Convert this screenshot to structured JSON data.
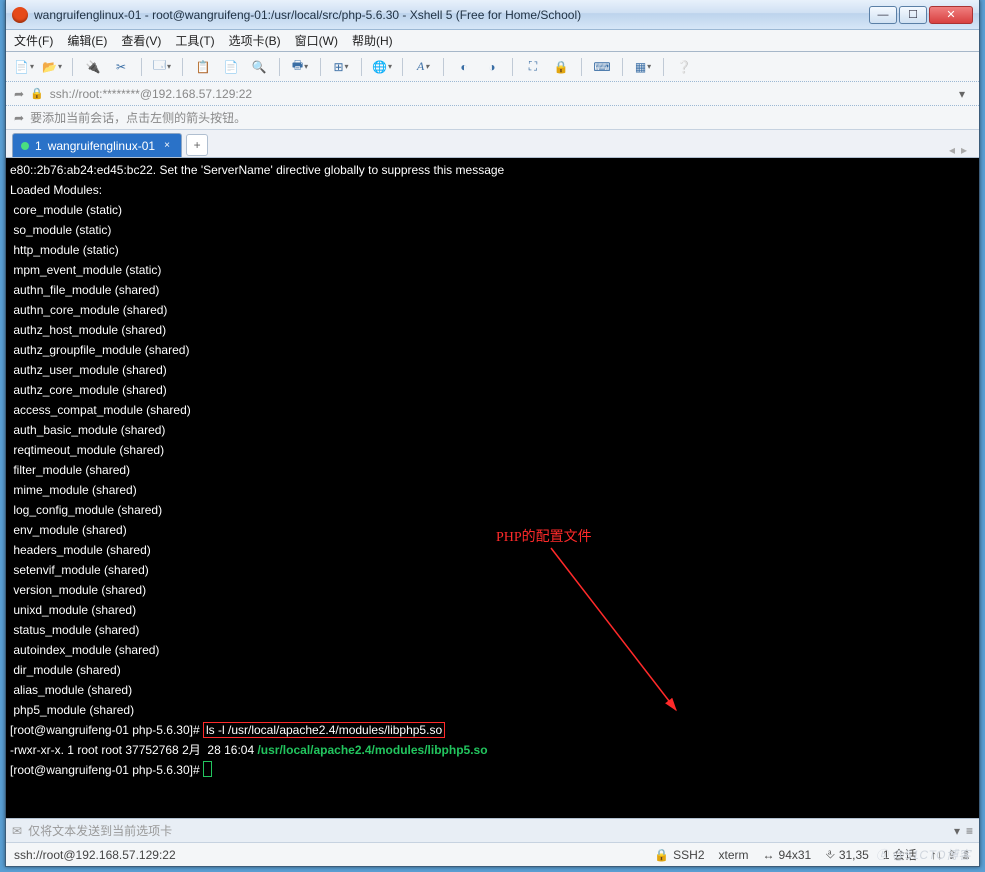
{
  "window": {
    "title": "wangruifenglinux-01 - root@wangruifeng-01:/usr/local/src/php-5.6.30 - Xshell 5 (Free for Home/School)"
  },
  "menubar": {
    "file": "文件(F)",
    "edit": "编辑(E)",
    "view": "查看(V)",
    "tools": "工具(T)",
    "tabs": "选项卡(B)",
    "window": "窗口(W)",
    "help": "帮助(H)"
  },
  "addressbar": {
    "text": "ssh://root:********@192.168.57.129:22"
  },
  "infobar": {
    "text": "要添加当前会话，点击左侧的箭头按钮。"
  },
  "tab": {
    "index": "1",
    "name": "wangruifenglinux-01"
  },
  "annotation": {
    "label": "PHP的配置文件"
  },
  "terminal": {
    "l0": "e80::2b76:ab24:ed45:bc22. Set the 'ServerName' directive globally to suppress this message",
    "l1": "Loaded Modules:",
    "l2": " core_module (static)",
    "l3": " so_module (static)",
    "l4": " http_module (static)",
    "l5": " mpm_event_module (static)",
    "l6": " authn_file_module (shared)",
    "l7": " authn_core_module (shared)",
    "l8": " authz_host_module (shared)",
    "l9": " authz_groupfile_module (shared)",
    "l10": " authz_user_module (shared)",
    "l11": " authz_core_module (shared)",
    "l12": " access_compat_module (shared)",
    "l13": " auth_basic_module (shared)",
    "l14": " reqtimeout_module (shared)",
    "l15": " filter_module (shared)",
    "l16": " mime_module (shared)",
    "l17": " log_config_module (shared)",
    "l18": " env_module (shared)",
    "l19": " headers_module (shared)",
    "l20": " setenvif_module (shared)",
    "l21": " version_module (shared)",
    "l22": " unixd_module (shared)",
    "l23": " status_module (shared)",
    "l24": " autoindex_module (shared)",
    "l25": " dir_module (shared)",
    "l26": " alias_module (shared)",
    "l27": " php5_module (shared)",
    "prompt1_pre": "[root@wangruifeng-01 php-5.6.30]# ",
    "prompt1_cmd": "ls -l /usr/local/apache2.4/modules/libphp5.so",
    "lsline_pre": "-rwxr-xr-x. 1 root root 37752768 2月  28 16:04 ",
    "lsline_path": "/usr/local/apache2.4/modules/libphp5.so",
    "prompt2": "[root@wangruifeng-01 php-5.6.30]# "
  },
  "sendbar": {
    "placeholder": "仅将文本发送到当前选项卡"
  },
  "statusbar": {
    "conn": "ssh://root@192.168.57.129:22",
    "proto": "SSH2",
    "term": "xterm",
    "size": "94x31",
    "cursor": "31,35",
    "sessions": "1 会话"
  },
  "watermark": "ⓑ @51CTO博客"
}
